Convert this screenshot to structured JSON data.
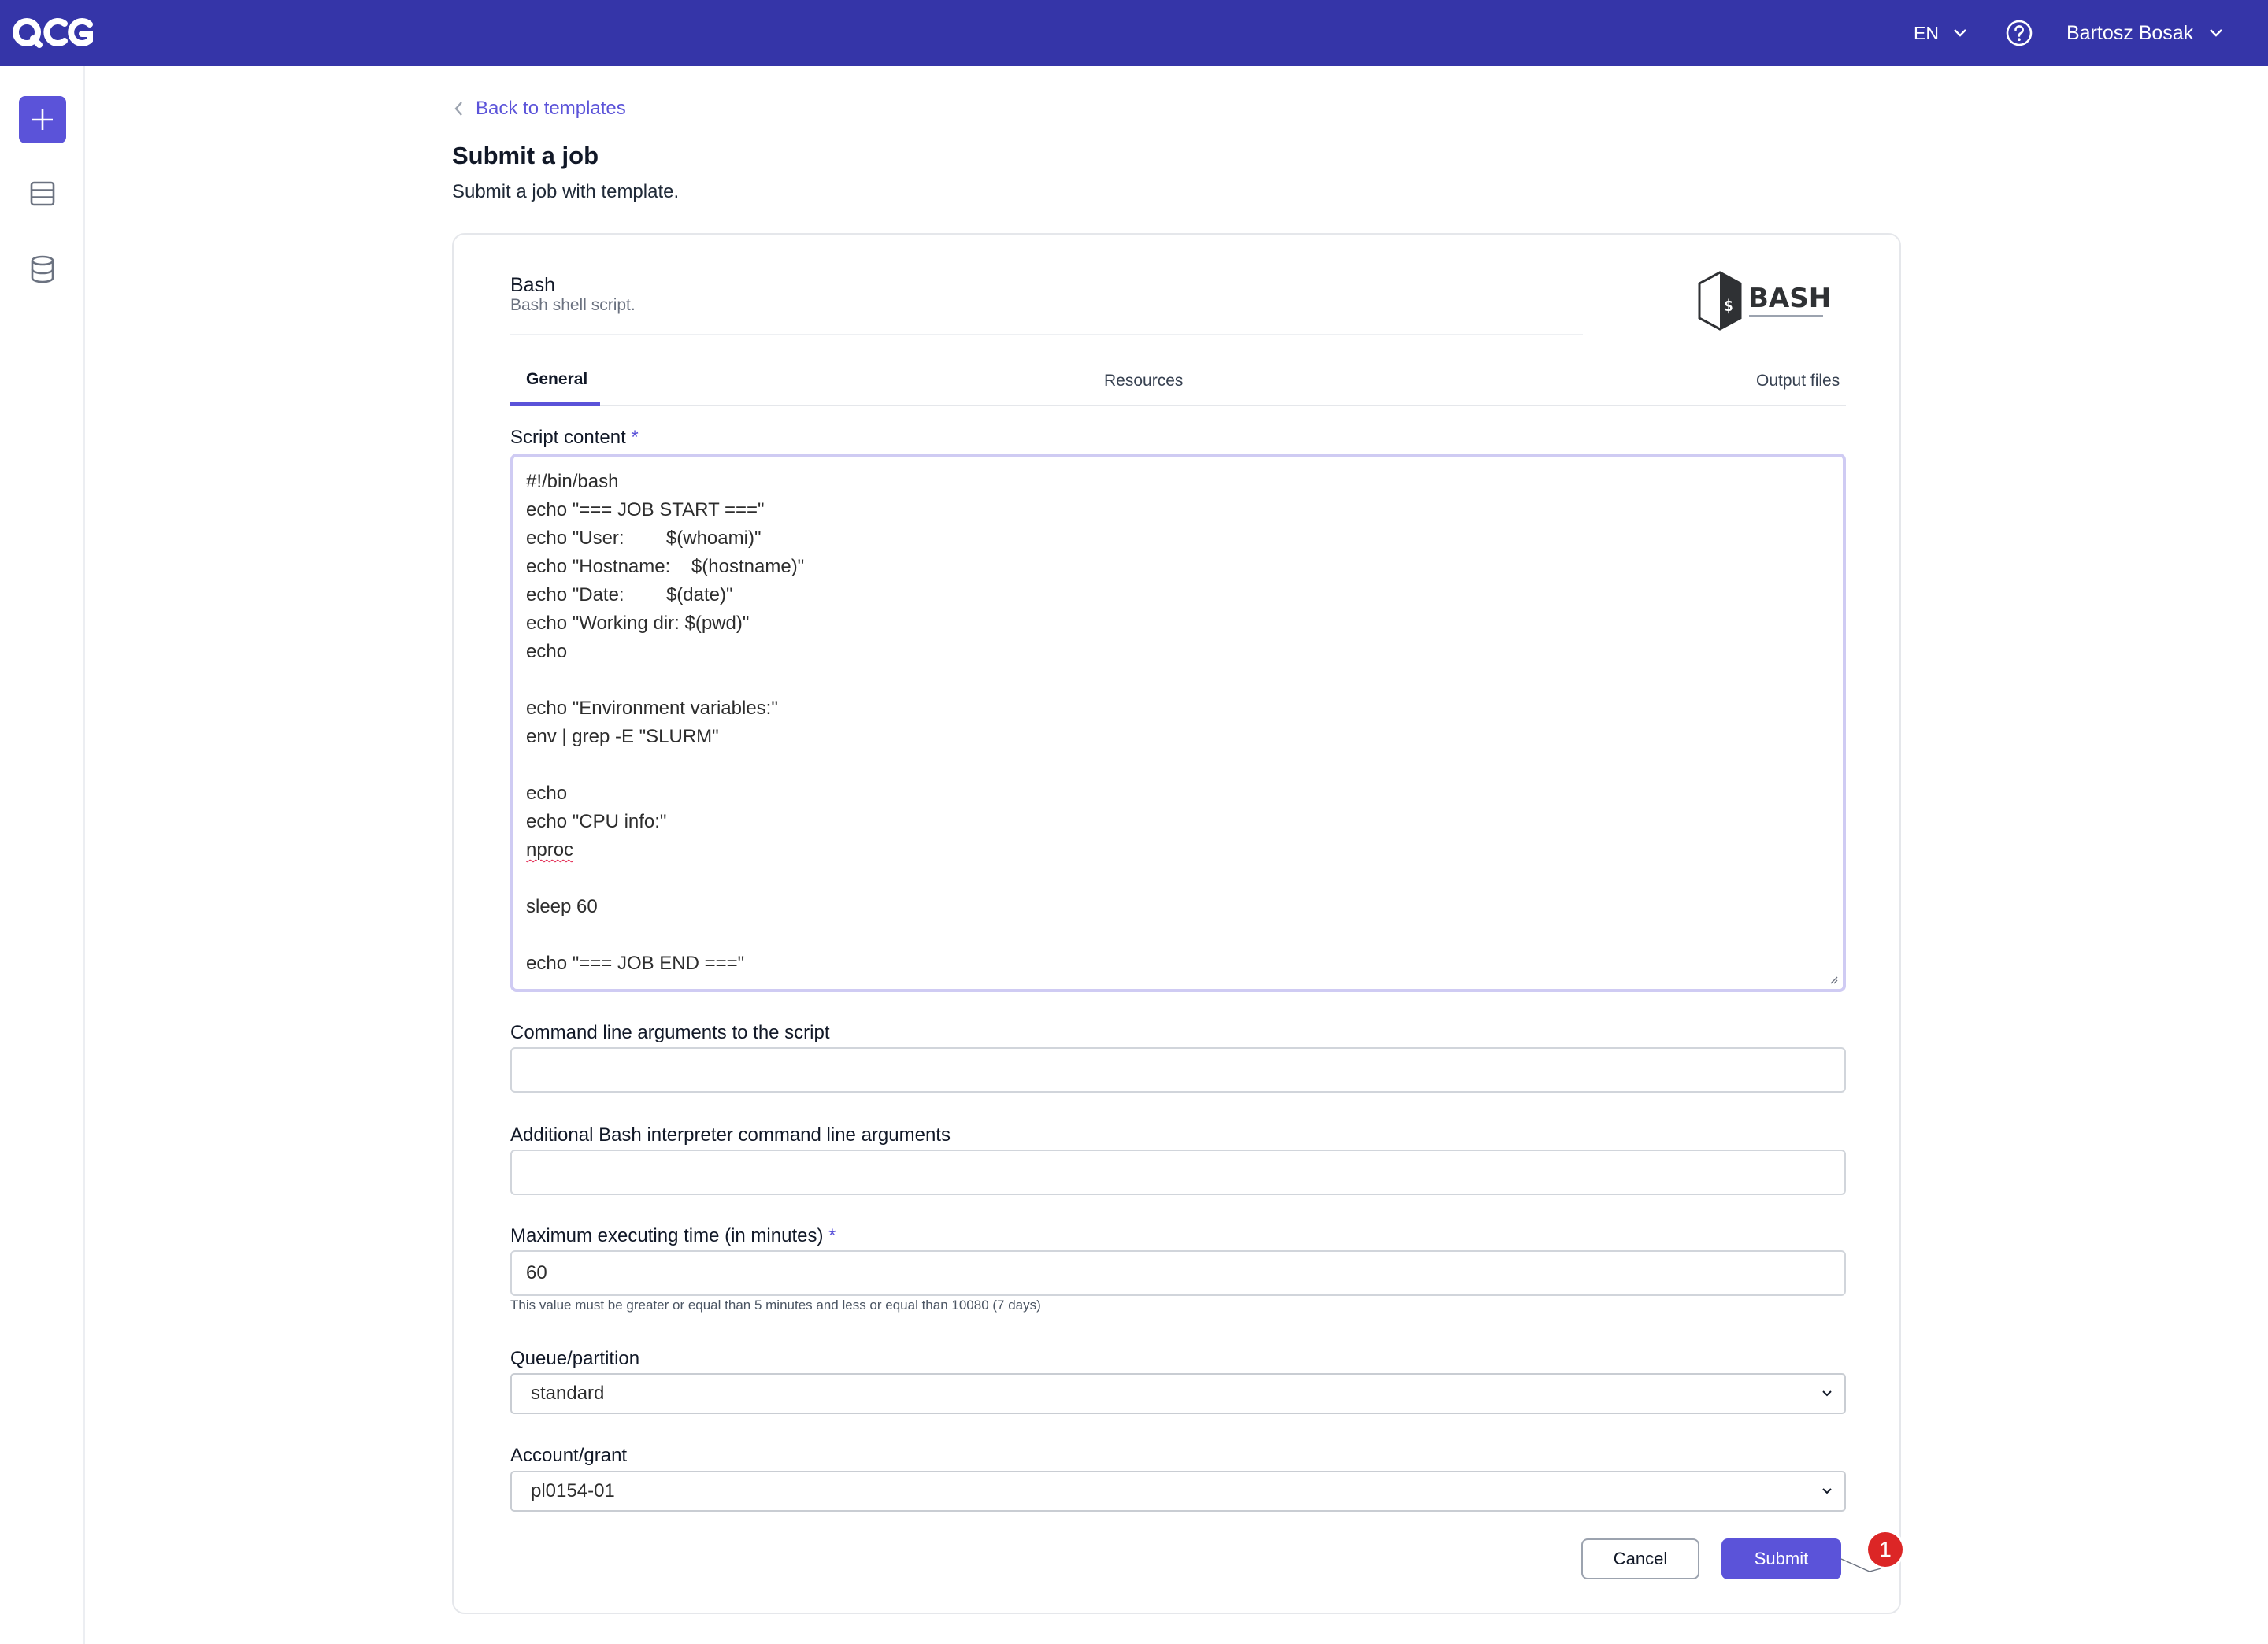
{
  "topbar": {
    "logo_text": "QCG",
    "language": "EN",
    "user_name": "Bartosz Bosak",
    "bg_color": "#3535a8"
  },
  "rail": {
    "items": [
      "plus-icon",
      "table-icon",
      "database-icon"
    ],
    "accent": "#5b53d9"
  },
  "header": {
    "back_label": "Back to templates",
    "title": "Submit a job",
    "subtitle": "Submit a job with template."
  },
  "template": {
    "name": "Bash",
    "description": "Bash shell script.",
    "logo_text": "BASH"
  },
  "tabs": [
    {
      "label": "General",
      "active": true
    },
    {
      "label": "Resources",
      "active": false
    },
    {
      "label": "Output files",
      "active": false
    }
  ],
  "form": {
    "script": {
      "label": "Script content",
      "required_mark": "*",
      "lines": [
        "#!/bin/bash",
        "echo \"=== JOB START ===\"",
        "echo \"User:        $(whoami)\"",
        "echo \"Hostname:    $(hostname)\"",
        "echo \"Date:        $(date)\"",
        "echo \"Working dir: $(pwd)\"",
        "echo",
        "",
        "echo \"Environment variables:\"",
        "env | grep -E \"SLURM\"",
        "",
        "echo",
        "echo \"CPU info:\"",
        "nproc",
        "",
        "sleep 60",
        "",
        "echo \"=== JOB END ===\""
      ]
    },
    "cmd_args": {
      "label": "Command line arguments to the script",
      "value": ""
    },
    "bash_args": {
      "label": "Additional Bash interpreter command line arguments",
      "value": ""
    },
    "max_time": {
      "label": "Maximum executing time (in minutes)",
      "required_mark": "*",
      "value": "60",
      "hint": "This value must be greater or equal than 5 minutes and less or equal than 10080 (7 days)"
    },
    "queue": {
      "label": "Queue/partition",
      "value": "standard"
    },
    "account": {
      "label": "Account/grant",
      "value": "pl0154-01"
    }
  },
  "actions": {
    "cancel_label": "Cancel",
    "submit_label": "Submit",
    "callout_number": "1"
  }
}
